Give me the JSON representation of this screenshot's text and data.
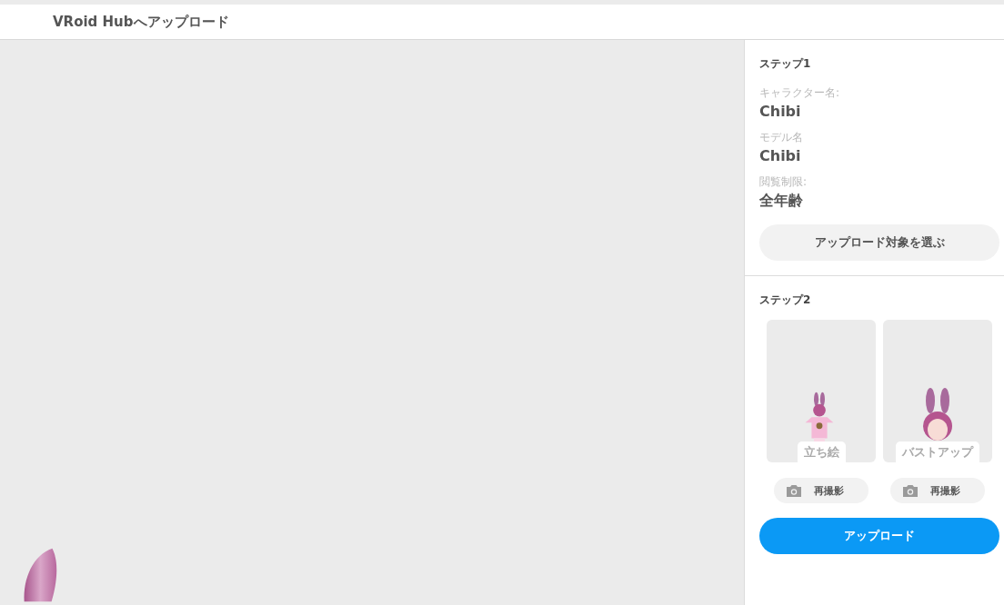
{
  "header": {
    "title": "VRoid Hubへアップロード"
  },
  "step1": {
    "heading": "ステップ1",
    "fields": [
      {
        "label": "キャラクター名:",
        "value": "Chibi"
      },
      {
        "label": "モデル名",
        "value": "Chibi"
      },
      {
        "label": "閲覧制限:",
        "value": "全年齢"
      }
    ],
    "select_button": "アップロード対象を選ぶ"
  },
  "step2": {
    "heading": "ステップ2",
    "shots": [
      {
        "kind": "full",
        "label": "立ち絵",
        "retake": "再撮影"
      },
      {
        "kind": "bust",
        "label": "バストアップ",
        "retake": "再撮影"
      }
    ]
  },
  "upload_button": "アップロード"
}
